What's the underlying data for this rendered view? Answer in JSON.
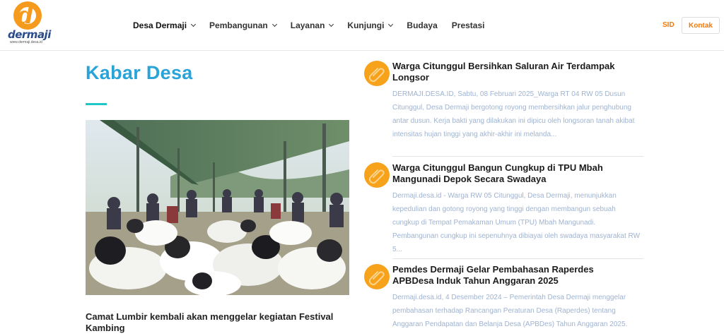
{
  "brand": {
    "logo_letter": "d",
    "logo_name": "dermaji",
    "logo_url": "www.dermaji.desa.id"
  },
  "nav": {
    "items": [
      {
        "label": "Desa Dermaji",
        "has_dropdown": true
      },
      {
        "label": "Pembangunan",
        "has_dropdown": true
      },
      {
        "label": "Layanan",
        "has_dropdown": true
      },
      {
        "label": "Kunjungi",
        "has_dropdown": true
      },
      {
        "label": "Budaya",
        "has_dropdown": false
      },
      {
        "label": "Prestasi",
        "has_dropdown": false
      }
    ],
    "sid": "SID",
    "kontak": "Kontak"
  },
  "section": {
    "title": "Kabar Desa"
  },
  "featured": {
    "caption": "Camat Lumbir kembali akan menggelar kegiatan Festival Kambing"
  },
  "news": [
    {
      "title": "Warga Citunggul Bersihkan Saluran Air Terdampak Longsor",
      "excerpt": "DERMAJI.DESA.ID, Sabtu, 08 Februari 2025_Warga RT 04 RW 05 Dusun Citunggul, Desa Dermaji bergotong royong membersihkan jalur penghubung antar dusun.  Kerja bakti yang dilakukan ini dipicu oleh longsoran tanah akibat intensitas hujan tinggi yang akhir-akhir ini melanda..."
    },
    {
      "title": "Warga Citunggul Bangun Cungkup di TPU Mbah Mangunadi Depok Secara Swadaya",
      "excerpt": "Dermaji.desa.id - Warga RW 05 Citunggul, Desa Dermaji, menunjukkan kepedulian dan gotong royong yang tinggi dengan membangun sebuah cungkup di Tempat Pemakaman Umum (TPU) Mbah Mangunadi. Pembangunan cungkup ini sepenuhnya dibiayai oleh swadaya masyarakat RW 5..."
    },
    {
      "title": "Pemdes Dermaji Gelar Pembahasan Raperdes APBDesa Induk Tahun Anggaran 2025",
      "excerpt": "Dermaji.desa.id, 4 Desember 2024 – Pemerintah Desa Dermaji menggelar pembahasan terhadap Rancangan Peraturan Desa (Raperdes) tentang Anggaran Pendapatan dan Belanja Desa (APBDes) Tahun Anggaran 2025."
    }
  ],
  "colors": {
    "accent_orange": "#f59a1c",
    "title_blue": "#2aa3d9",
    "bar_teal": "#1fc8c8",
    "excerpt_blue": "#9fb3d1"
  },
  "icons": {
    "news_icon": "paperclip-icon",
    "dropdown_icon": "chevron-down-icon"
  }
}
